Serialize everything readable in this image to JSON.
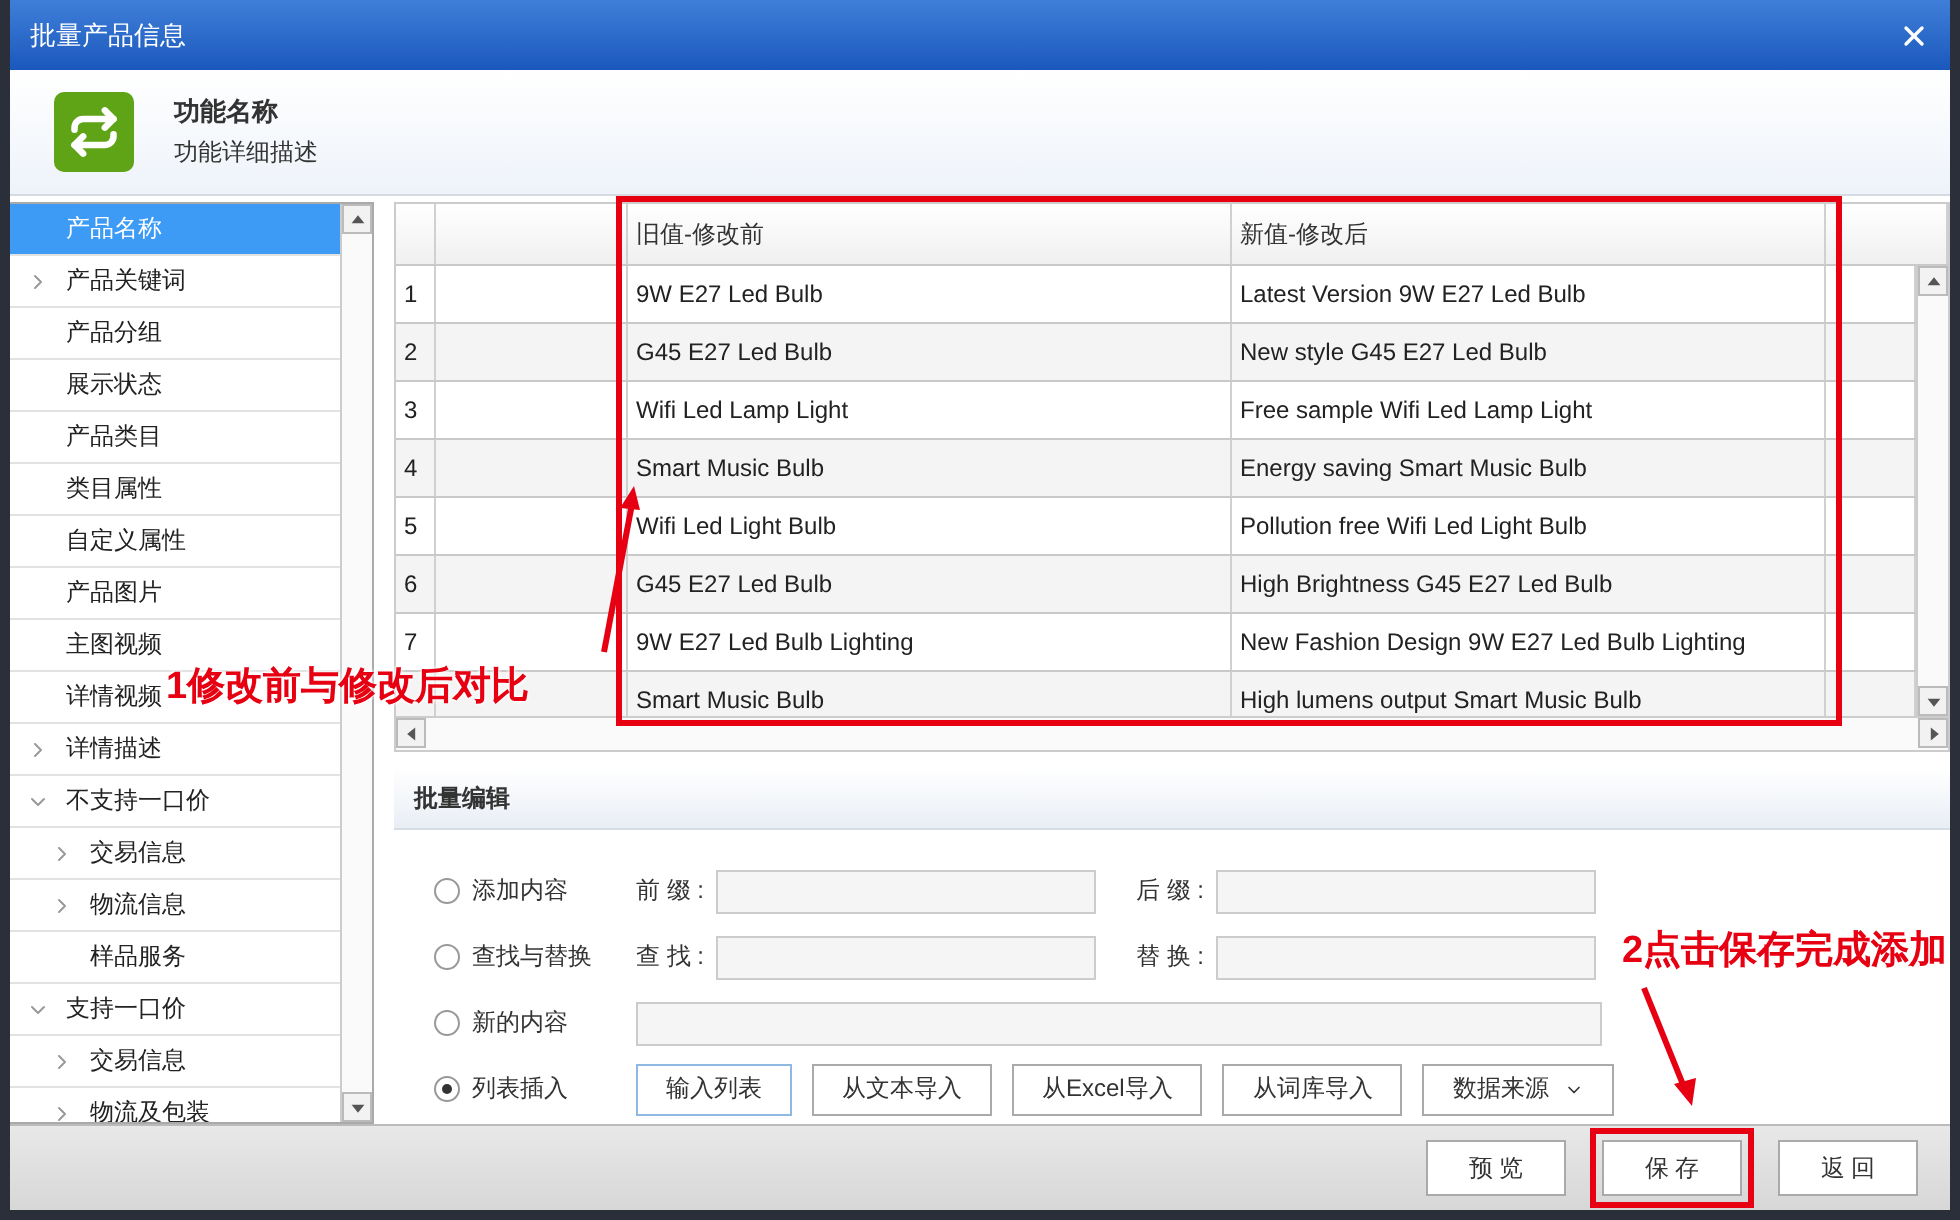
{
  "window": {
    "title": "批量产品信息"
  },
  "header": {
    "title": "功能名称",
    "subtitle": "功能详细描述"
  },
  "sidebar": {
    "items": [
      {
        "label": "产品名称",
        "kind": "leaf",
        "selected": true
      },
      {
        "label": "产品关键词",
        "kind": "group",
        "expanded": false,
        "selected": false
      },
      {
        "label": "产品分组",
        "kind": "leaf",
        "selected": false
      },
      {
        "label": "展示状态",
        "kind": "leaf",
        "selected": false
      },
      {
        "label": "产品类目",
        "kind": "leaf",
        "selected": false
      },
      {
        "label": "类目属性",
        "kind": "leaf",
        "selected": false
      },
      {
        "label": "自定义属性",
        "kind": "leaf",
        "selected": false
      },
      {
        "label": "产品图片",
        "kind": "leaf",
        "selected": false
      },
      {
        "label": "主图视频",
        "kind": "leaf",
        "selected": false
      },
      {
        "label": "详情视频",
        "kind": "leaf",
        "selected": false
      },
      {
        "label": "详情描述",
        "kind": "group",
        "expanded": false,
        "selected": false
      },
      {
        "label": "不支持一口价",
        "kind": "group",
        "expanded": true,
        "selected": false,
        "children": [
          {
            "label": "交易信息",
            "kind": "group",
            "expanded": false,
            "selected": false
          },
          {
            "label": "物流信息",
            "kind": "group",
            "expanded": false,
            "selected": false
          },
          {
            "label": "样品服务",
            "kind": "leaf",
            "selected": false
          }
        ]
      },
      {
        "label": "支持一口价",
        "kind": "group",
        "expanded": true,
        "selected": false,
        "children": [
          {
            "label": "交易信息",
            "kind": "group",
            "expanded": false,
            "selected": false
          },
          {
            "label": "物流及包装",
            "kind": "group",
            "expanded": false,
            "selected": false
          }
        ]
      }
    ]
  },
  "table": {
    "columns": [
      "旧值-修改前",
      "新值-修改后"
    ],
    "rows": [
      {
        "number": "1",
        "old": "9W E27 Led Bulb",
        "new": "Latest Version  9W E27 Led Bulb"
      },
      {
        "number": "2",
        "old": "G45 E27 Led Bulb",
        "new": "New style G45 E27 Led Bulb"
      },
      {
        "number": "3",
        "old": "Wifi Led Lamp Light",
        "new": "Free sample Wifi Led Lamp Light"
      },
      {
        "number": "4",
        "old": "Smart Music Bulb",
        "new": "Energy saving Smart Music Bulb"
      },
      {
        "number": "5",
        "old": "Wifi Led Light Bulb",
        "new": "Pollution free  Wifi Led Light Bulb"
      },
      {
        "number": "6",
        "old": "G45 E27 Led Bulb",
        "new": "High Brightness G45 E27 Led Bulb"
      },
      {
        "number": "7",
        "old": "9W E27 Led Bulb Lighting",
        "new": "New Fashion Design  9W E27 Led Bulb Lighting"
      },
      {
        "old": "Smart Music Bulb",
        "new": "High lumens output Smart Music Bulb"
      }
    ]
  },
  "batch_edit": {
    "title": "批量编辑",
    "options": [
      {
        "label": "添加内容",
        "selected": false,
        "kind": "pair",
        "fields": [
          {
            "label": "前 缀 :"
          },
          {
            "label": "后 缀 :"
          }
        ]
      },
      {
        "label": "查找与替换",
        "selected": false,
        "kind": "pair",
        "fields": [
          {
            "label": "查 找 :"
          },
          {
            "label": "替 换 :"
          }
        ]
      },
      {
        "label": "新的内容",
        "selected": false,
        "kind": "single"
      },
      {
        "label": "列表插入",
        "selected": true,
        "kind": "buttons",
        "buttons": [
          {
            "label": "输入列表",
            "selected": true,
            "kind": "plain"
          },
          {
            "label": "从文本导入",
            "selected": false,
            "kind": "plain"
          },
          {
            "label": "从Excel导入",
            "selected": false,
            "kind": "plain"
          },
          {
            "label": "从词库导入",
            "selected": false,
            "kind": "plain"
          },
          {
            "label": "数据来源",
            "selected": false,
            "kind": "dropdown"
          }
        ]
      }
    ]
  },
  "footer": {
    "buttons": [
      {
        "label": "预 览",
        "highlighted": false
      },
      {
        "label": "保 存",
        "highlighted": true
      },
      {
        "label": "返 回",
        "highlighted": false
      }
    ]
  },
  "annotations": [
    {
      "text": "1修改前与修改后对比"
    },
    {
      "text": "2点击保存完成添加"
    }
  ]
}
